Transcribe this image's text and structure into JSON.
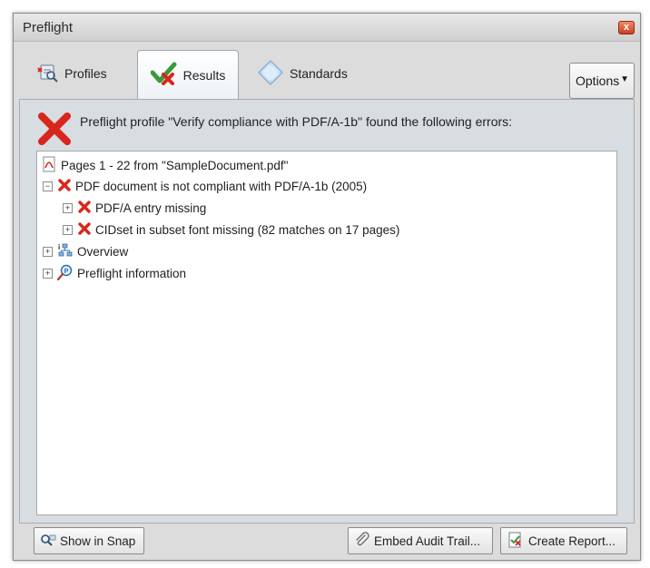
{
  "window": {
    "title": "Preflight",
    "close_glyph": "x"
  },
  "tabs": [
    {
      "label": "Profiles",
      "icon": "profiles-icon"
    },
    {
      "label": "Results",
      "icon": "results-checkmark-icon",
      "selected": true
    },
    {
      "label": "Standards",
      "icon": "standards-diamond-icon"
    }
  ],
  "options": {
    "label": "Options"
  },
  "summary": {
    "icon": "error-x-icon",
    "text": "Preflight profile \"Verify compliance with PDF/A-1b\" found the following errors:"
  },
  "tree": [
    {
      "label": "Pages 1 - 22 from \"SampleDocument.pdf\"",
      "icon": "pdf-document-icon",
      "expander": ""
    },
    {
      "label": "PDF document is not compliant with PDF/A-1b (2005)",
      "icon": "error-x-icon",
      "expander": "−"
    },
    {
      "label": "PDF/A entry missing",
      "icon": "error-x-icon",
      "expander": "+"
    },
    {
      "label": "CIDset in subset font missing (82 matches on 17 pages)",
      "icon": "error-x-icon",
      "expander": "+"
    },
    {
      "label": "Overview",
      "icon": "overview-icon",
      "expander": "+"
    },
    {
      "label": "Preflight information",
      "icon": "info-magnifier-icon",
      "expander": "+"
    }
  ],
  "buttons": {
    "show_in_snap": "Show in Snap",
    "embed_audit_trail": "Embed Audit Trail...",
    "create_report": "Create Report..."
  },
  "colors": {
    "error_red": "#d9261c",
    "check_green": "#3a9a3a"
  }
}
